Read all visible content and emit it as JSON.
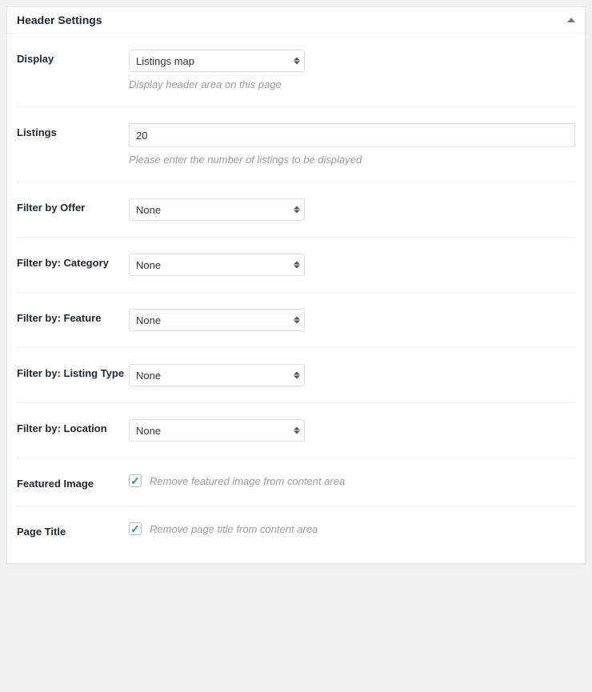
{
  "panel": {
    "title": "Header Settings"
  },
  "fields": {
    "display": {
      "label": "Display",
      "value": "Listings map",
      "help": "Display header area on this page"
    },
    "listings": {
      "label": "Listings",
      "value": "20",
      "help": "Please enter the number of listings to be displayed"
    },
    "filter_offer": {
      "label": "Filter by Offer",
      "value": "None"
    },
    "filter_category": {
      "label": "Filter by: Category",
      "value": "None"
    },
    "filter_feature": {
      "label": "Filter by: Feature",
      "value": "None"
    },
    "filter_listing_type": {
      "label": "Filter by: Listing Type",
      "value": "None"
    },
    "filter_location": {
      "label": "Filter by: Location",
      "value": "None"
    },
    "featured_image": {
      "label": "Featured Image",
      "checkbox_label": "Remove featured image from content area",
      "checked": true
    },
    "page_title": {
      "label": "Page Title",
      "checkbox_label": "Remove page title from content area",
      "checked": true
    }
  }
}
